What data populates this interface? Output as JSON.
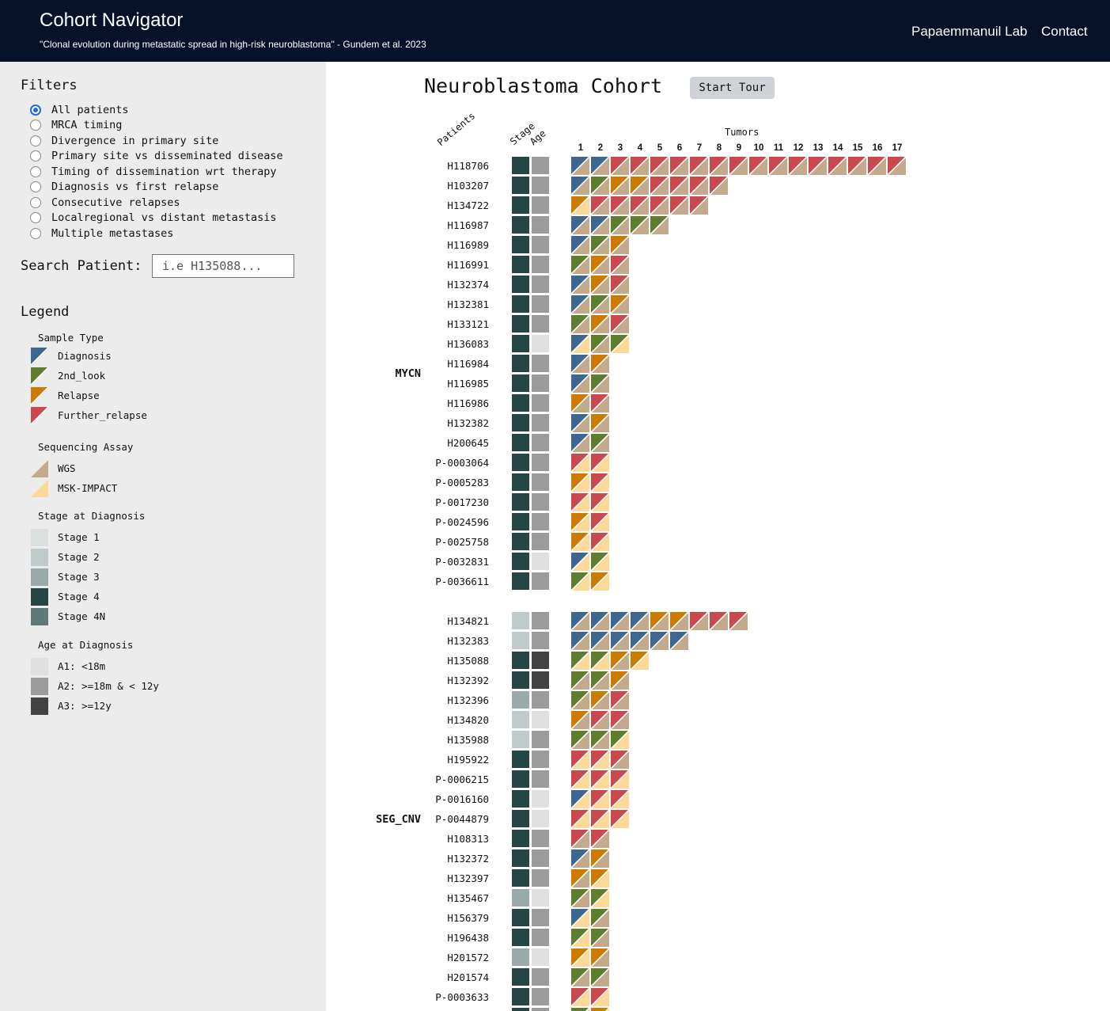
{
  "header": {
    "title": "Cohort Navigator",
    "subtitle": "\"Clonal evolution during metastatic spread in high-risk neuroblastoma\" - Gundem et al. 2023",
    "nav": [
      "Papaemmanuil Lab",
      "Contact"
    ]
  },
  "sidebar": {
    "filters_title": "Filters",
    "filters": [
      {
        "label": "All patients",
        "checked": true
      },
      {
        "label": "MRCA timing",
        "checked": false
      },
      {
        "label": "Divergence in primary site",
        "checked": false
      },
      {
        "label": "Primary site vs disseminated disease",
        "checked": false
      },
      {
        "label": "Timing of dissemination wrt therapy",
        "checked": false
      },
      {
        "label": "Diagnosis vs first relapse",
        "checked": false
      },
      {
        "label": "Consecutive relapses",
        "checked": false
      },
      {
        "label": "Localregional vs distant metastasis",
        "checked": false
      },
      {
        "label": "Multiple metastases",
        "checked": false
      }
    ],
    "search": {
      "label": "Search Patient:",
      "placeholder": "i.e H135088..."
    },
    "legend": {
      "title": "Legend",
      "sample_type": {
        "title": "Sample Type",
        "items": [
          {
            "label": "Diagnosis",
            "color": "#3d6791"
          },
          {
            "label": "2nd_look",
            "color": "#5e7d2f"
          },
          {
            "label": "Relapse",
            "color": "#cc7a00"
          },
          {
            "label": "Further_relapse",
            "color": "#c9494f"
          }
        ]
      },
      "assay": {
        "title": "Sequencing Assay",
        "items": [
          {
            "label": "WGS",
            "color": "#c4aa8c"
          },
          {
            "label": "MSK-IMPACT",
            "color": "#fcd999"
          }
        ]
      },
      "stage": {
        "title": "Stage at Diagnosis",
        "items": [
          {
            "label": "Stage 1",
            "color": "#dadfdf"
          },
          {
            "label": "Stage 2",
            "color": "#bfcaca"
          },
          {
            "label": "Stage 3",
            "color": "#9aaaaa"
          },
          {
            "label": "Stage 4",
            "color": "#264545"
          },
          {
            "label": "Stage 4N",
            "color": "#607979"
          }
        ]
      },
      "age": {
        "title": "Age at Diagnosis",
        "items": [
          {
            "label": "A1: <18m",
            "color": "#e0e0e0"
          },
          {
            "label": "A2: >=18m & < 12y",
            "color": "#9b9b9b"
          },
          {
            "label": "A3: >=12y",
            "color": "#424242"
          }
        ]
      }
    }
  },
  "main": {
    "title": "Neuroblastoma Cohort",
    "tour_button": "Start Tour",
    "col_patients": "Patients",
    "col_stage": "Stage",
    "col_age": "Age",
    "tumors_label": "Tumors",
    "tumor_numbers": [
      "1",
      "2",
      "3",
      "4",
      "5",
      "6",
      "7",
      "8",
      "9",
      "10",
      "11",
      "12",
      "13",
      "14",
      "15",
      "16",
      "17"
    ],
    "groups": [
      {
        "name": "MYCN",
        "rows": [
          {
            "id": "H118706",
            "stage": "4",
            "age": "A2",
            "samples": [
              "DW",
              "DW",
              "FW",
              "FW",
              "FW",
              "FW",
              "FW",
              "FW",
              "FW",
              "FW",
              "FW",
              "FW",
              "FW",
              "FW",
              "FW",
              "FW",
              "FW"
            ]
          },
          {
            "id": "H103207",
            "stage": "4",
            "age": "A2",
            "samples": [
              "DW",
              "SW",
              "RW",
              "RW",
              "FW",
              "FW",
              "FW",
              "FW"
            ]
          },
          {
            "id": "H134722",
            "stage": "4",
            "age": "A2",
            "samples": [
              "RM",
              "FW",
              "FW",
              "FW",
              "FW",
              "FW",
              "FW"
            ]
          },
          {
            "id": "H116987",
            "stage": "4",
            "age": "A2",
            "samples": [
              "DW",
              "DW",
              "SW",
              "SW",
              "SW"
            ]
          },
          {
            "id": "H116989",
            "stage": "4",
            "age": "A2",
            "samples": [
              "DW",
              "SW",
              "RW"
            ]
          },
          {
            "id": "H116991",
            "stage": "4",
            "age": "A2",
            "samples": [
              "SW",
              "RW",
              "FW"
            ]
          },
          {
            "id": "H132374",
            "stage": "4",
            "age": "A2",
            "samples": [
              "DW",
              "RW",
              "FW"
            ]
          },
          {
            "id": "H132381",
            "stage": "4",
            "age": "A2",
            "samples": [
              "DW",
              "SW",
              "RW"
            ]
          },
          {
            "id": "H133121",
            "stage": "4",
            "age": "A2",
            "samples": [
              "SW",
              "RW",
              "FW"
            ]
          },
          {
            "id": "H136083",
            "stage": "4",
            "age": "A1",
            "samples": [
              "DM",
              "SW",
              "SM"
            ]
          },
          {
            "id": "H116984",
            "stage": "4",
            "age": "A2",
            "samples": [
              "DW",
              "RW"
            ]
          },
          {
            "id": "H116985",
            "stage": "4",
            "age": "A2",
            "samples": [
              "DW",
              "SW"
            ]
          },
          {
            "id": "H116986",
            "stage": "4",
            "age": "A2",
            "samples": [
              "RW",
              "FW"
            ]
          },
          {
            "id": "H132382",
            "stage": "4",
            "age": "A2",
            "samples": [
              "DW",
              "RW"
            ]
          },
          {
            "id": "H200645",
            "stage": "4",
            "age": "A2",
            "samples": [
              "DW",
              "SW"
            ]
          },
          {
            "id": "P-0003064",
            "stage": "4",
            "age": "A2",
            "samples": [
              "FM",
              "FM"
            ]
          },
          {
            "id": "P-0005283",
            "stage": "4",
            "age": "A2",
            "samples": [
              "RM",
              "FM"
            ]
          },
          {
            "id": "P-0017230",
            "stage": "4",
            "age": "A2",
            "samples": [
              "FM",
              "FM"
            ]
          },
          {
            "id": "P-0024596",
            "stage": "4",
            "age": "A2",
            "samples": [
              "RM",
              "FM"
            ]
          },
          {
            "id": "P-0025758",
            "stage": "4",
            "age": "A2",
            "samples": [
              "RM",
              "FM"
            ]
          },
          {
            "id": "P-0032831",
            "stage": "4",
            "age": "A1",
            "samples": [
              "DM",
              "SM"
            ]
          },
          {
            "id": "P-0036611",
            "stage": "4",
            "age": "A2",
            "samples": [
              "SM",
              "RM"
            ]
          }
        ]
      },
      {
        "name": "SEG_CNV",
        "rows": [
          {
            "id": "H134821",
            "stage": "2",
            "age": "A2",
            "samples": [
              "DW",
              "DW",
              "DW",
              "DW",
              "RW",
              "RW",
              "FW",
              "FW",
              "FW"
            ]
          },
          {
            "id": "H132383",
            "stage": "2",
            "age": "A2",
            "samples": [
              "DW",
              "DW",
              "DW",
              "DW",
              "DW",
              "DW"
            ]
          },
          {
            "id": "H135088",
            "stage": "4",
            "age": "A3",
            "samples": [
              "SM",
              "SM",
              "RW",
              "RM"
            ]
          },
          {
            "id": "H132392",
            "stage": "4",
            "age": "A3",
            "samples": [
              "SW",
              "SW",
              "RW"
            ]
          },
          {
            "id": "H132396",
            "stage": "3",
            "age": "A2",
            "samples": [
              "SW",
              "RW",
              "FW"
            ]
          },
          {
            "id": "H134820",
            "stage": "2",
            "age": "A1",
            "samples": [
              "RW",
              "FW",
              "FW"
            ]
          },
          {
            "id": "H135988",
            "stage": "2",
            "age": "A2",
            "samples": [
              "SW",
              "SW",
              "SM"
            ]
          },
          {
            "id": "H195922",
            "stage": "4",
            "age": "A2",
            "samples": [
              "FM",
              "FM",
              "FW"
            ]
          },
          {
            "id": "P-0006215",
            "stage": "4",
            "age": "A2",
            "samples": [
              "FM",
              "FM",
              "FM"
            ]
          },
          {
            "id": "P-0016160",
            "stage": "4",
            "age": "A1",
            "samples": [
              "DM",
              "FM",
              "FM"
            ]
          },
          {
            "id": "P-0044879",
            "stage": "4",
            "age": "A1",
            "samples": [
              "FM",
              "FM",
              "FM"
            ]
          },
          {
            "id": "H108313",
            "stage": "4",
            "age": "A2",
            "samples": [
              "FW",
              "FW"
            ]
          },
          {
            "id": "H132372",
            "stage": "4",
            "age": "A2",
            "samples": [
              "DW",
              "RW"
            ]
          },
          {
            "id": "H132397",
            "stage": "4",
            "age": "A2",
            "samples": [
              "RW",
              "RM"
            ]
          },
          {
            "id": "H135467",
            "stage": "3",
            "age": "A1",
            "samples": [
              "SW",
              "SM"
            ]
          },
          {
            "id": "H156379",
            "stage": "4",
            "age": "A2",
            "samples": [
              "DM",
              "SW"
            ]
          },
          {
            "id": "H196438",
            "stage": "4",
            "age": "A2",
            "samples": [
              "SM",
              "SW"
            ]
          },
          {
            "id": "H201572",
            "stage": "3",
            "age": "A1",
            "samples": [
              "RM",
              "RW"
            ]
          },
          {
            "id": "H201574",
            "stage": "4",
            "age": "A2",
            "samples": [
              "SW",
              "SW"
            ]
          },
          {
            "id": "P-0003633",
            "stage": "4",
            "age": "A2",
            "samples": [
              "FM",
              "FM"
            ]
          },
          {
            "id": "",
            "stage": "4",
            "age": "A2",
            "samples": [
              "SM",
              "RM"
            ]
          }
        ]
      }
    ]
  }
}
